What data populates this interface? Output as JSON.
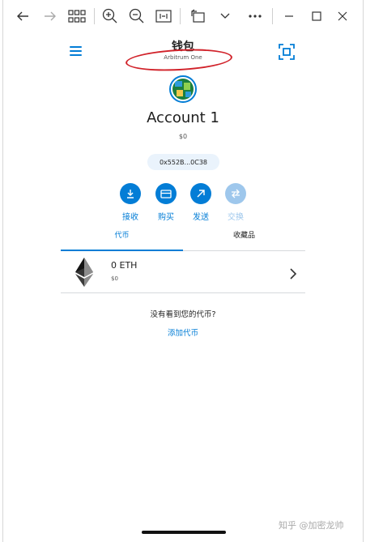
{
  "wallet": {
    "title": "钱包",
    "network": "Arbitrum One",
    "account_name": "Account 1",
    "balance": "$0",
    "address": "0x552B...0C38"
  },
  "actions": [
    {
      "label": "接收",
      "icon": "receive-icon"
    },
    {
      "label": "购买",
      "icon": "card-icon"
    },
    {
      "label": "发送",
      "icon": "send-icon"
    },
    {
      "label": "交换",
      "icon": "swap-icon"
    }
  ],
  "tabs": [
    {
      "label": "代币",
      "active": true
    },
    {
      "label": "收藏品",
      "active": false
    }
  ],
  "assets": [
    {
      "amount": "0 ETH",
      "fiat": "$0",
      "icon": "ethereum-icon"
    }
  ],
  "empty_state": {
    "prompt": "没有看到您的代币?",
    "link": "添加代币"
  },
  "watermark": "知乎 @加密龙帅",
  "colors": {
    "accent": "#037dd6",
    "disabled": "#9ec7ec",
    "highlight_ring": "#d1222a"
  }
}
